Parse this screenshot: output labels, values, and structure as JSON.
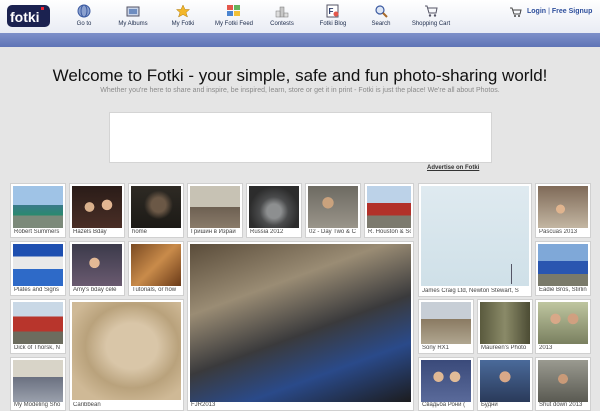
{
  "header": {
    "nav": [
      {
        "label": "Go to",
        "icon": "globe-icon"
      },
      {
        "label": "My Albums",
        "icon": "albums-icon"
      },
      {
        "label": "My Fotki",
        "icon": "star-icon"
      },
      {
        "label": "My Fotki Feed",
        "icon": "feed-icon"
      },
      {
        "label": "Contests",
        "icon": "podium-icon"
      },
      {
        "label": "Fotki Blog",
        "icon": "blog-icon"
      },
      {
        "label": "Search",
        "icon": "magnifier-icon"
      },
      {
        "label": "Shopping Cart",
        "icon": "cart-icon"
      }
    ],
    "login": "Login",
    "separator": "|",
    "signup": "Free Signup"
  },
  "hero": {
    "title": "Welcome to Fotki - your simple, safe and fun photo-sharing world!",
    "subtitle": "Whether you're here to share and inspire, be inspired, learn, store or get it in print - Fotki is just the place! We're all about Photos."
  },
  "ad": {
    "link": "Advertise on Fotki"
  },
  "photos": [
    {
      "caption": "Robert Summers"
    },
    {
      "caption": "Hazels Bday"
    },
    {
      "caption": "home"
    },
    {
      "caption": "Гришин в Израи"
    },
    {
      "caption": "Russia 2012"
    },
    {
      "caption": "02 - Day Two & C"
    },
    {
      "caption": "R. Houston & Sor"
    },
    {
      "caption": "James Craig Ltd, Newton Stewart, S"
    },
    {
      "caption": "Pascuas 2013"
    },
    {
      "caption": "Plates and Signs"
    },
    {
      "caption": "Amy's bday cele"
    },
    {
      "caption": "Tutorials, or how"
    },
    {
      "caption": "Eadie Bros, Stirlin"
    },
    {
      "caption": "Dick of Thorsk, N"
    },
    {
      "caption": "Caribbean"
    },
    {
      "caption": "FJR2013"
    },
    {
      "caption": "Sony RX1"
    },
    {
      "caption": "Maureen's Photo"
    },
    {
      "caption": "2013"
    },
    {
      "caption": "My Modeling Sho"
    },
    {
      "caption": "Свадьба Рони ("
    },
    {
      "caption": "Будни"
    },
    {
      "caption": "Shut down 2013"
    }
  ]
}
